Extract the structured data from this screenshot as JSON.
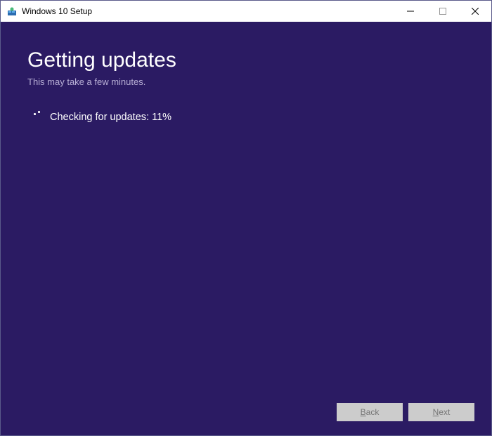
{
  "window": {
    "title": "Windows 10 Setup"
  },
  "content": {
    "heading": "Getting updates",
    "subheading": "This may take a few minutes.",
    "status_prefix": "Checking for updates: ",
    "progress_percent": "11%"
  },
  "buttons": {
    "back_char": "B",
    "back_rest": "ack",
    "next_char": "N",
    "next_rest": "ext"
  }
}
